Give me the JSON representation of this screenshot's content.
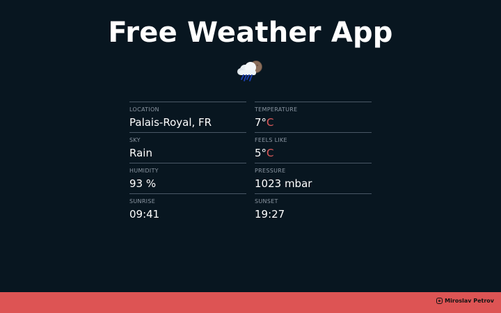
{
  "header": {
    "title": "Free Weather App",
    "weather_icon": "rain-cloud-moon-icon"
  },
  "weather": {
    "location": {
      "label": "Location",
      "value": "Palais-Royal, FR"
    },
    "temperature": {
      "label": "Temperature",
      "number": "7°",
      "unit": "C"
    },
    "sky": {
      "label": "Sky",
      "value": "Rain"
    },
    "feels_like": {
      "label": "Feels like",
      "number": "5°",
      "unit": "C"
    },
    "humidity": {
      "label": "Humidity",
      "value": "93 %"
    },
    "pressure": {
      "label": "Pressure",
      "value": "1023 mbar"
    },
    "sunrise": {
      "label": "Sunrise",
      "value": "09:41"
    },
    "sunset": {
      "label": "Sunset",
      "value": "19:27"
    }
  },
  "footer": {
    "author": "Miroslav Petrov",
    "author_icon": "instagram-icon",
    "background": "#dd5454"
  },
  "colors": {
    "background": "#081620",
    "accent": "#e05a5a"
  }
}
